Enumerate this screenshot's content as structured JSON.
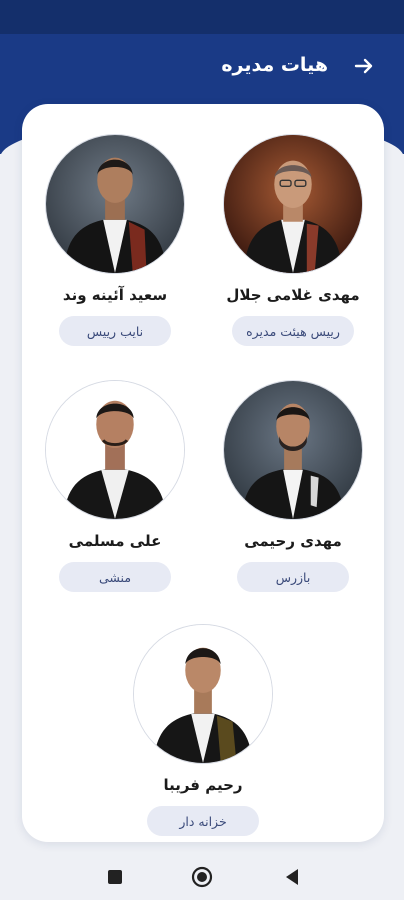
{
  "header": {
    "title": "هیات مدیره",
    "back_icon": "arrow-right-icon"
  },
  "colors": {
    "header": "#1a3a86",
    "status_bar": "#142f6b",
    "role_bg": "#e7eaf4",
    "role_text": "#3a4a7a"
  },
  "members": [
    {
      "name": "مهدی غلامی جلال",
      "role": "رییس هیئت مدیره",
      "photo": "portrait-1"
    },
    {
      "name": "سعید آئینه وند",
      "role": "نایب رییس",
      "photo": "portrait-2"
    },
    {
      "name": "مهدی رحیمی",
      "role": "بازرس",
      "photo": "portrait-3"
    },
    {
      "name": "علی مسلمی",
      "role": "منشی",
      "photo": "portrait-4"
    },
    {
      "name": "رحیم فریبا",
      "role": "خزانه دار",
      "photo": "portrait-5"
    }
  ],
  "nav": {
    "recent": "square-icon",
    "home": "circle-icon",
    "back": "triangle-back-icon"
  }
}
